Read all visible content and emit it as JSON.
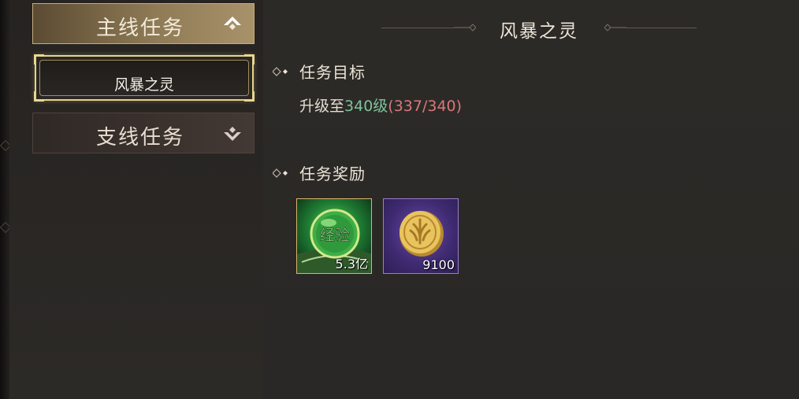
{
  "sidebar": {
    "main_category": {
      "label": "主线任务",
      "icon": "chevron-up-diamond-icon"
    },
    "side_category": {
      "label": "支线任务",
      "icon": "chevron-down-diamond-icon"
    },
    "selected_quest": {
      "label": "风暴之灵"
    }
  },
  "main": {
    "title": "风暴之灵",
    "objective_section": {
      "label": "任务目标"
    },
    "objective": {
      "prefix": "升级至",
      "target": "340级",
      "progress": "(337/340)",
      "current": 337,
      "required": 340
    },
    "reward_section": {
      "label": "任务奖励"
    },
    "rewards": [
      {
        "name": "经验",
        "amount": "5.3亿",
        "icon": "experience-orb-icon"
      },
      {
        "name": "",
        "amount": "9100",
        "icon": "gold-coin-icon"
      }
    ]
  },
  "colors": {
    "accent_gold": "#e6d489",
    "objective_green": "#7fc39b",
    "progress_red": "#d8787c",
    "panel_bg": "#2a2826"
  }
}
